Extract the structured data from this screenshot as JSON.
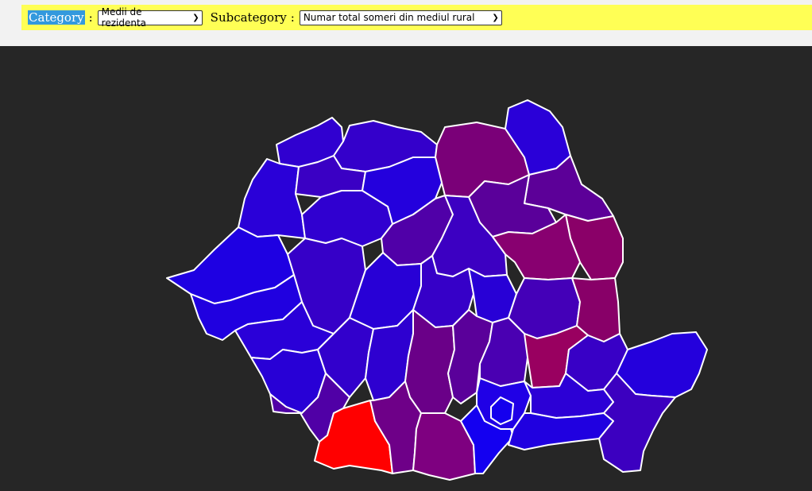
{
  "toolbar": {
    "category_label": "Category",
    "category_value": "Medii de rezidenta",
    "subcategory_label": "Subcategory",
    "subcategory_value": "Numar total someri din mediul rural",
    "colon": ":"
  },
  "map": {
    "color_scale": {
      "low": "#1a00ff",
      "high": "#ff0000"
    },
    "counties": [
      {
        "name": "Satu Mare",
        "color": "#3000d0"
      },
      {
        "name": "Maramures",
        "color": "#3400cb"
      },
      {
        "name": "Suceava",
        "color": "#7a0078"
      },
      {
        "name": "Botosani",
        "color": "#2a00d8"
      },
      {
        "name": "Bihor",
        "color": "#2a00d8"
      },
      {
        "name": "Salaj",
        "color": "#3a00c4"
      },
      {
        "name": "Bistrita-Nasaud",
        "color": "#2400dd"
      },
      {
        "name": "Iasi",
        "color": "#5c0098"
      },
      {
        "name": "Cluj",
        "color": "#3000d0"
      },
      {
        "name": "Mures",
        "color": "#5000a8"
      },
      {
        "name": "Neamt",
        "color": "#5a009a"
      },
      {
        "name": "Vaslui",
        "color": "#8a0068"
      },
      {
        "name": "Arad",
        "color": "#1e00e2"
      },
      {
        "name": "Alba",
        "color": "#3600c8"
      },
      {
        "name": "Harghita",
        "color": "#3c00c2"
      },
      {
        "name": "Bacau",
        "color": "#880070"
      },
      {
        "name": "Timis",
        "color": "#2000e0"
      },
      {
        "name": "Hunedoara",
        "color": "#2a00d8"
      },
      {
        "name": "Sibiu",
        "color": "#2800d6"
      },
      {
        "name": "Brasov",
        "color": "#3600c8"
      },
      {
        "name": "Covasna",
        "color": "#2800d6"
      },
      {
        "name": "Vrancea",
        "color": "#4400b8"
      },
      {
        "name": "Galati",
        "color": "#880068"
      },
      {
        "name": "Caras-Severin",
        "color": "#2800d6"
      },
      {
        "name": "Gorj",
        "color": "#3200cc"
      },
      {
        "name": "Valcea",
        "color": "#2e00d0"
      },
      {
        "name": "Arges",
        "color": "#6a0088"
      },
      {
        "name": "Dambovita",
        "color": "#5a009a"
      },
      {
        "name": "Prahova",
        "color": "#4a00b2"
      },
      {
        "name": "Buzau",
        "color": "#990060"
      },
      {
        "name": "Braila",
        "color": "#3800c6"
      },
      {
        "name": "Tulcea",
        "color": "#2400dc"
      },
      {
        "name": "Mehedinti",
        "color": "#5000a6"
      },
      {
        "name": "Dolj",
        "color": "#ff0000"
      },
      {
        "name": "Olt",
        "color": "#6e0088"
      },
      {
        "name": "Teleorman",
        "color": "#7e0080"
      },
      {
        "name": "Giurgiu",
        "color": "#1400f0"
      },
      {
        "name": "Ilfov",
        "color": "#2000e6"
      },
      {
        "name": "Bucuresti",
        "color": "#1400ee"
      },
      {
        "name": "Ialomita",
        "color": "#2c00d6"
      },
      {
        "name": "Calarasi",
        "color": "#2000e0"
      },
      {
        "name": "Constanta",
        "color": "#3c00c0"
      }
    ]
  }
}
